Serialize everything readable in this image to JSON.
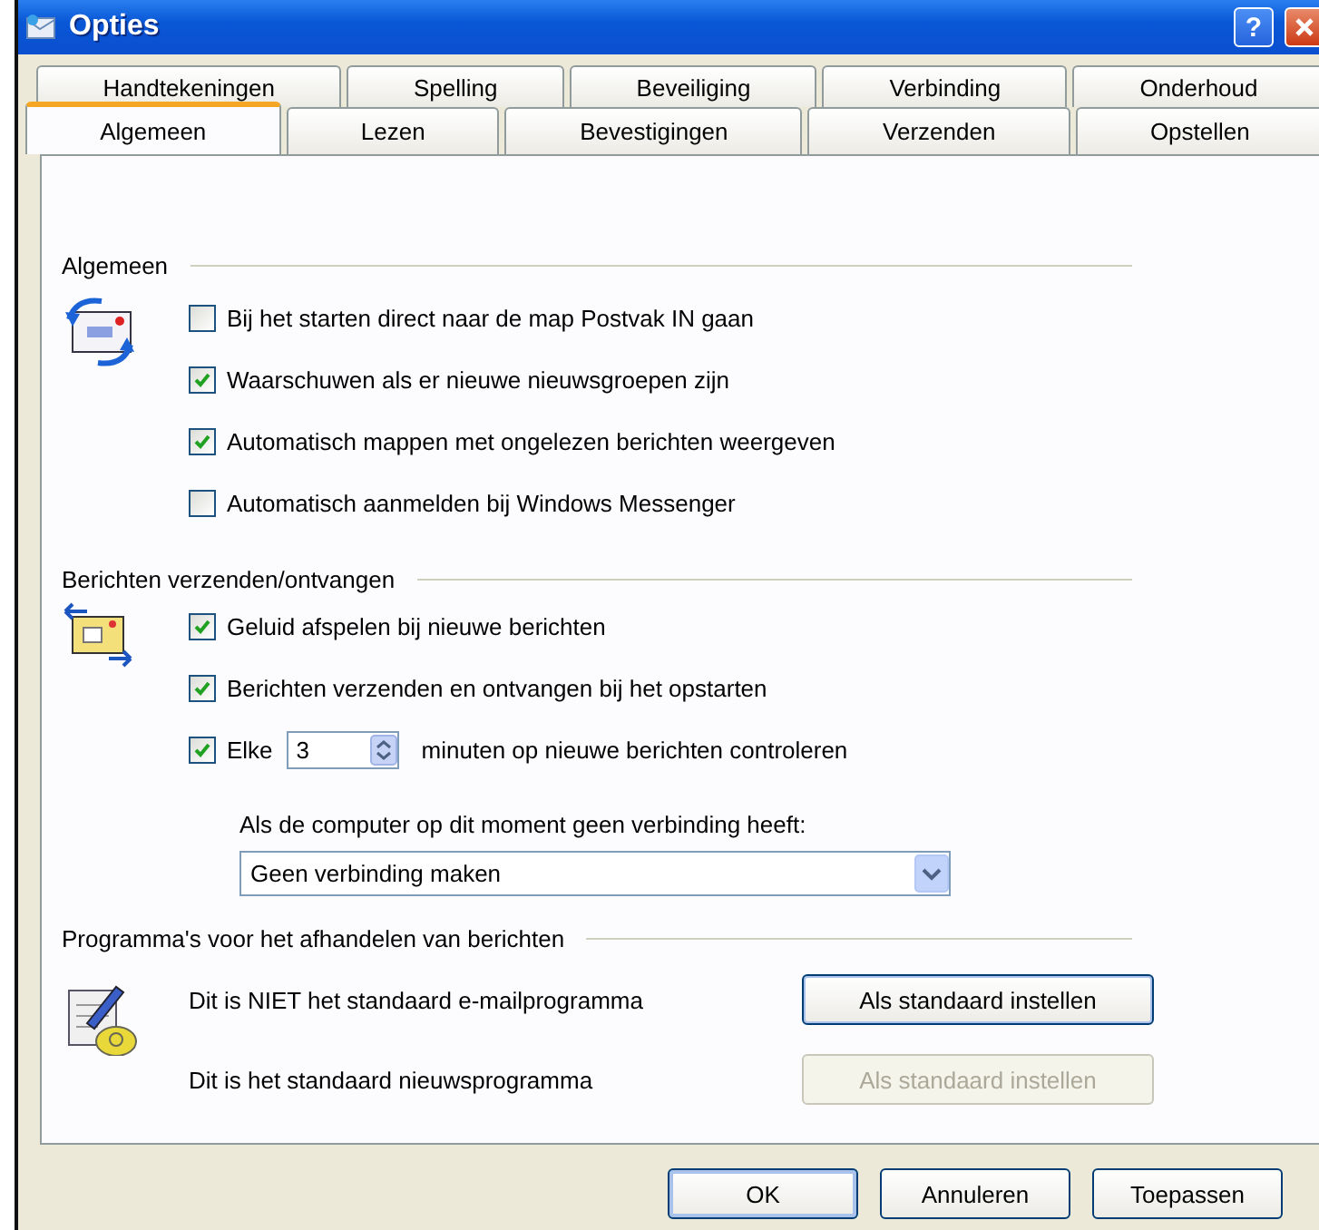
{
  "window": {
    "title": "Opties",
    "help_button": "?"
  },
  "tab_rows": [
    [
      {
        "label": "Handtekeningen",
        "selected": false
      },
      {
        "label": "Spelling",
        "selected": false
      },
      {
        "label": "Beveiliging",
        "selected": false
      },
      {
        "label": "Verbinding",
        "selected": false
      },
      {
        "label": "Onderhoud",
        "selected": false
      }
    ],
    [
      {
        "label": "Algemeen",
        "selected": true
      },
      {
        "label": "Lezen",
        "selected": false
      },
      {
        "label": "Bevestigingen",
        "selected": false
      },
      {
        "label": "Verzenden",
        "selected": false
      },
      {
        "label": "Opstellen",
        "selected": false
      }
    ]
  ],
  "sections": [
    {
      "title": "Algemeen",
      "items": [
        {
          "kind": "checkbox",
          "label": "Bij het starten direct naar de map Postvak IN gaan",
          "checked": false
        },
        {
          "kind": "checkbox",
          "label": "Waarschuwen als er nieuwe nieuwsgroepen zijn",
          "checked": true
        },
        {
          "kind": "checkbox",
          "label": "Automatisch mappen met ongelezen berichten weergeven",
          "checked": true
        },
        {
          "kind": "checkbox",
          "label": "Automatisch aanmelden bij Windows Messenger",
          "checked": false
        }
      ]
    },
    {
      "title": "Berichten verzenden/ontvangen",
      "items": [
        {
          "kind": "checkbox",
          "label": "Geluid afspelen bij nieuwe berichten",
          "checked": true
        },
        {
          "kind": "checkbox",
          "label": "Berichten verzenden en ontvangen bij het opstarten",
          "checked": true
        },
        {
          "kind": "interval",
          "label": "Elke",
          "checked": true,
          "value": "3",
          "suffix": "minuten op nieuwe berichten controleren"
        },
        {
          "kind": "note",
          "text": "Als de computer op dit moment geen verbinding heeft:"
        },
        {
          "kind": "dropdown",
          "value": "Geen verbinding maken"
        }
      ]
    },
    {
      "title": "Programma's voor het afhandelen van berichten",
      "items": [
        {
          "kind": "default_program",
          "text": "Dit is NIET het standaard e-mailprogramma",
          "button": {
            "label": "Als standaard instellen",
            "disabled": false
          }
        },
        {
          "kind": "default_program",
          "text": "Dit is het standaard nieuwsprogramma",
          "button": {
            "label": "Als standaard instellen",
            "disabled": true
          }
        }
      ]
    }
  ],
  "buttons": [
    {
      "label": "OK"
    },
    {
      "label": "Annuleren"
    },
    {
      "label": "Toepassen"
    }
  ]
}
